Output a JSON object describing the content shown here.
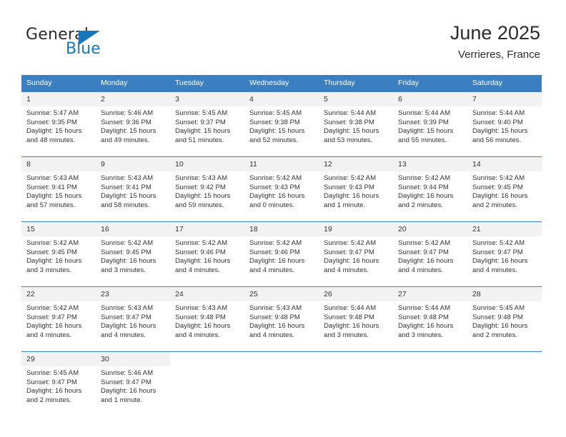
{
  "logo": {
    "word1": "General",
    "word2": "Blue",
    "triangle_color": "#1b75bb"
  },
  "header": {
    "title": "June 2025",
    "subtitle": "Verrieres, France"
  },
  "theme": {
    "header_blue": "#3c7fc1",
    "daynum_band": "#f2f2f2",
    "text": "#333333"
  },
  "calendar": {
    "weekday_headers": [
      "Sunday",
      "Monday",
      "Tuesday",
      "Wednesday",
      "Thursday",
      "Friday",
      "Saturday"
    ],
    "weeks": [
      [
        {
          "day": "1",
          "sunrise": "Sunrise: 5:47 AM",
          "sunset": "Sunset: 9:35 PM",
          "daylight": "Daylight: 15 hours and 48 minutes."
        },
        {
          "day": "2",
          "sunrise": "Sunrise: 5:46 AM",
          "sunset": "Sunset: 9:36 PM",
          "daylight": "Daylight: 15 hours and 49 minutes."
        },
        {
          "day": "3",
          "sunrise": "Sunrise: 5:45 AM",
          "sunset": "Sunset: 9:37 PM",
          "daylight": "Daylight: 15 hours and 51 minutes."
        },
        {
          "day": "4",
          "sunrise": "Sunrise: 5:45 AM",
          "sunset": "Sunset: 9:38 PM",
          "daylight": "Daylight: 15 hours and 52 minutes."
        },
        {
          "day": "5",
          "sunrise": "Sunrise: 5:44 AM",
          "sunset": "Sunset: 9:38 PM",
          "daylight": "Daylight: 15 hours and 53 minutes."
        },
        {
          "day": "6",
          "sunrise": "Sunrise: 5:44 AM",
          "sunset": "Sunset: 9:39 PM",
          "daylight": "Daylight: 15 hours and 55 minutes."
        },
        {
          "day": "7",
          "sunrise": "Sunrise: 5:44 AM",
          "sunset": "Sunset: 9:40 PM",
          "daylight": "Daylight: 15 hours and 56 minutes."
        }
      ],
      [
        {
          "day": "8",
          "sunrise": "Sunrise: 5:43 AM",
          "sunset": "Sunset: 9:41 PM",
          "daylight": "Daylight: 15 hours and 57 minutes."
        },
        {
          "day": "9",
          "sunrise": "Sunrise: 5:43 AM",
          "sunset": "Sunset: 9:41 PM",
          "daylight": "Daylight: 15 hours and 58 minutes."
        },
        {
          "day": "10",
          "sunrise": "Sunrise: 5:43 AM",
          "sunset": "Sunset: 9:42 PM",
          "daylight": "Daylight: 15 hours and 59 minutes."
        },
        {
          "day": "11",
          "sunrise": "Sunrise: 5:42 AM",
          "sunset": "Sunset: 9:43 PM",
          "daylight": "Daylight: 16 hours and 0 minutes."
        },
        {
          "day": "12",
          "sunrise": "Sunrise: 5:42 AM",
          "sunset": "Sunset: 9:43 PM",
          "daylight": "Daylight: 16 hours and 1 minute."
        },
        {
          "day": "13",
          "sunrise": "Sunrise: 5:42 AM",
          "sunset": "Sunset: 9:44 PM",
          "daylight": "Daylight: 16 hours and 2 minutes."
        },
        {
          "day": "14",
          "sunrise": "Sunrise: 5:42 AM",
          "sunset": "Sunset: 9:45 PM",
          "daylight": "Daylight: 16 hours and 2 minutes."
        }
      ],
      [
        {
          "day": "15",
          "sunrise": "Sunrise: 5:42 AM",
          "sunset": "Sunset: 9:45 PM",
          "daylight": "Daylight: 16 hours and 3 minutes."
        },
        {
          "day": "16",
          "sunrise": "Sunrise: 5:42 AM",
          "sunset": "Sunset: 9:45 PM",
          "daylight": "Daylight: 16 hours and 3 minutes."
        },
        {
          "day": "17",
          "sunrise": "Sunrise: 5:42 AM",
          "sunset": "Sunset: 9:46 PM",
          "daylight": "Daylight: 16 hours and 4 minutes."
        },
        {
          "day": "18",
          "sunrise": "Sunrise: 5:42 AM",
          "sunset": "Sunset: 9:46 PM",
          "daylight": "Daylight: 16 hours and 4 minutes."
        },
        {
          "day": "19",
          "sunrise": "Sunrise: 5:42 AM",
          "sunset": "Sunset: 9:47 PM",
          "daylight": "Daylight: 16 hours and 4 minutes."
        },
        {
          "day": "20",
          "sunrise": "Sunrise: 5:42 AM",
          "sunset": "Sunset: 9:47 PM",
          "daylight": "Daylight: 16 hours and 4 minutes."
        },
        {
          "day": "21",
          "sunrise": "Sunrise: 5:42 AM",
          "sunset": "Sunset: 9:47 PM",
          "daylight": "Daylight: 16 hours and 4 minutes."
        }
      ],
      [
        {
          "day": "22",
          "sunrise": "Sunrise: 5:42 AM",
          "sunset": "Sunset: 9:47 PM",
          "daylight": "Daylight: 16 hours and 4 minutes."
        },
        {
          "day": "23",
          "sunrise": "Sunrise: 5:43 AM",
          "sunset": "Sunset: 9:47 PM",
          "daylight": "Daylight: 16 hours and 4 minutes."
        },
        {
          "day": "24",
          "sunrise": "Sunrise: 5:43 AM",
          "sunset": "Sunset: 9:48 PM",
          "daylight": "Daylight: 16 hours and 4 minutes."
        },
        {
          "day": "25",
          "sunrise": "Sunrise: 5:43 AM",
          "sunset": "Sunset: 9:48 PM",
          "daylight": "Daylight: 16 hours and 4 minutes."
        },
        {
          "day": "26",
          "sunrise": "Sunrise: 5:44 AM",
          "sunset": "Sunset: 9:48 PM",
          "daylight": "Daylight: 16 hours and 3 minutes."
        },
        {
          "day": "27",
          "sunrise": "Sunrise: 5:44 AM",
          "sunset": "Sunset: 9:48 PM",
          "daylight": "Daylight: 16 hours and 3 minutes."
        },
        {
          "day": "28",
          "sunrise": "Sunrise: 5:45 AM",
          "sunset": "Sunset: 9:48 PM",
          "daylight": "Daylight: 16 hours and 2 minutes."
        }
      ],
      [
        {
          "day": "29",
          "sunrise": "Sunrise: 5:45 AM",
          "sunset": "Sunset: 9:47 PM",
          "daylight": "Daylight: 16 hours and 2 minutes."
        },
        {
          "day": "30",
          "sunrise": "Sunrise: 5:46 AM",
          "sunset": "Sunset: 9:47 PM",
          "daylight": "Daylight: 16 hours and 1 minute."
        },
        {
          "day": "",
          "sunrise": "",
          "sunset": "",
          "daylight": ""
        },
        {
          "day": "",
          "sunrise": "",
          "sunset": "",
          "daylight": ""
        },
        {
          "day": "",
          "sunrise": "",
          "sunset": "",
          "daylight": ""
        },
        {
          "day": "",
          "sunrise": "",
          "sunset": "",
          "daylight": ""
        },
        {
          "day": "",
          "sunrise": "",
          "sunset": "",
          "daylight": ""
        }
      ]
    ]
  }
}
